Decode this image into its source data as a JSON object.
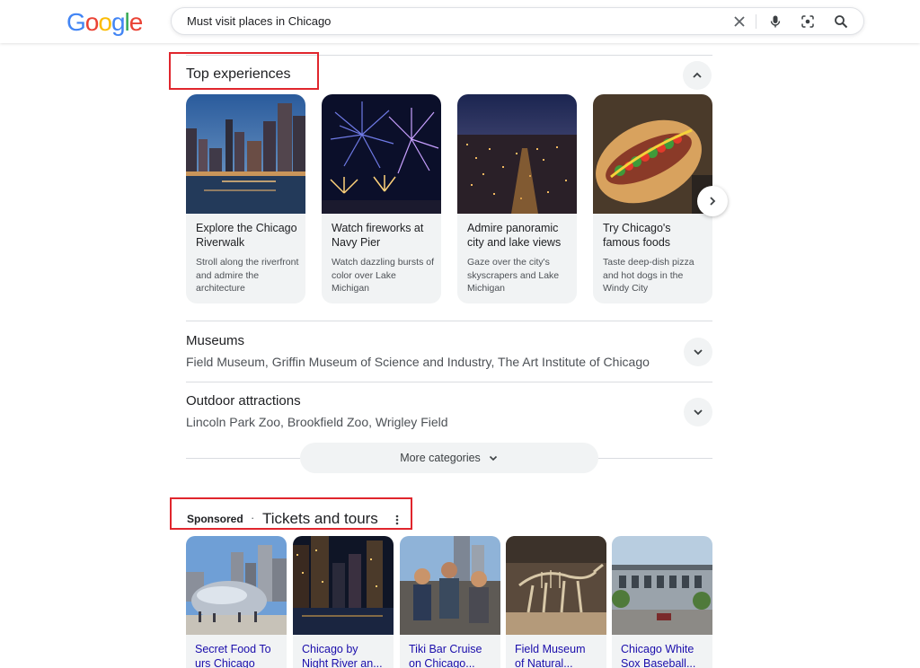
{
  "search": {
    "query": "Must visit places in Chicago",
    "logo_letters": [
      {
        "ch": "G",
        "color": "#4285F4"
      },
      {
        "ch": "o",
        "color": "#EA4335"
      },
      {
        "ch": "o",
        "color": "#FBBC05"
      },
      {
        "ch": "g",
        "color": "#4285F4"
      },
      {
        "ch": "l",
        "color": "#34A853"
      },
      {
        "ch": "e",
        "color": "#EA4335"
      }
    ],
    "icons": [
      "clear-icon",
      "microphone-icon",
      "lens-icon",
      "search-icon"
    ]
  },
  "top_experiences": {
    "title": "Top experiences",
    "cards": [
      {
        "title": "Explore the Chicago Riverwalk",
        "desc": "Stroll along the riverfront and admire the architecture"
      },
      {
        "title": "Watch fireworks at Navy Pier",
        "desc": "Watch dazzling bursts of color over Lake Michigan"
      },
      {
        "title": "Admire panoramic city and lake views",
        "desc": "Gaze over the city's skyscrapers and Lake Michigan"
      },
      {
        "title": "Try Chicago's famous foods",
        "desc": "Taste deep-dish pizza and hot dogs in the Windy City"
      }
    ]
  },
  "categories": [
    {
      "title": "Museums",
      "items": "Field Museum, Griffin Museum of Science and Industry, The Art Institute of Chicago"
    },
    {
      "title": "Outdoor attractions",
      "items": "Lincoln Park Zoo, Brookfield Zoo, Wrigley Field"
    }
  ],
  "more_categories_label": "More categories",
  "tickets": {
    "sponsored": "Sponsored",
    "separator": "·",
    "title": "Tickets and tours",
    "cards": [
      {
        "line1": "Secret Food To",
        "line2": "urs Chicago"
      },
      {
        "line1": "Chicago by",
        "line2": "Night River an..."
      },
      {
        "line1": "Tiki Bar Cruise",
        "line2": "on Chicago..."
      },
      {
        "line1": "Field Museum",
        "line2": "of Natural..."
      },
      {
        "line1": "Chicago White",
        "line2": "Sox Baseball..."
      }
    ]
  },
  "colors": {
    "highlight": "#e0262d",
    "link": "#1a0dab",
    "chip": "#f1f3f4"
  }
}
